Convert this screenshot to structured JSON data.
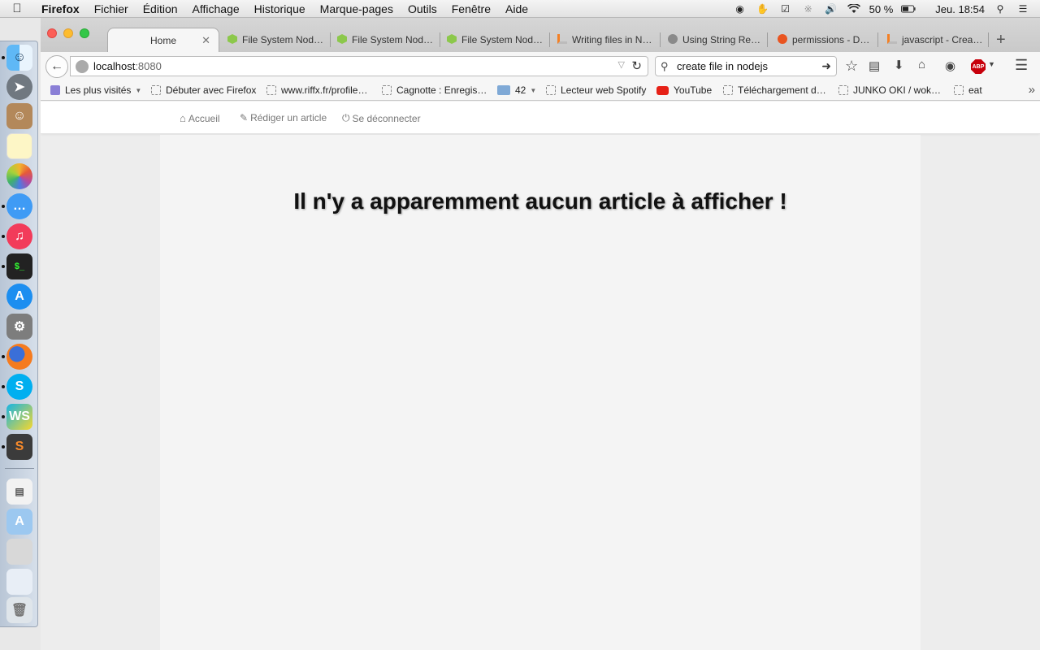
{
  "menubar": {
    "app": "Firefox",
    "items": [
      "Fichier",
      "Édition",
      "Affichage",
      "Historique",
      "Marque-pages",
      "Outils",
      "Fenêtre",
      "Aide"
    ],
    "battery": "50 %",
    "clock": "Jeu. 18:54"
  },
  "tabs": [
    {
      "label": "Home",
      "active": true
    },
    {
      "label": "File System Nod…"
    },
    {
      "label": "File System Nod…"
    },
    {
      "label": "File System Nod…"
    },
    {
      "label": "Writing files in N…"
    },
    {
      "label": "Using String Re…"
    },
    {
      "label": "permissions - D…"
    },
    {
      "label": "javascript - Crea…"
    }
  ],
  "navbar": {
    "url_host": "localhost",
    "url_port": ":8080",
    "search_value": "create file in nodejs"
  },
  "bookmarks": [
    {
      "label": "Les plus visités"
    },
    {
      "label": "Débuter avec Firefox"
    },
    {
      "label": "www.riffx.fr/profile…"
    },
    {
      "label": "Cagnotte : Enregis…"
    },
    {
      "label": "42"
    },
    {
      "label": "Lecteur web Spotify"
    },
    {
      "label": "YouTube"
    },
    {
      "label": "Téléchargement d…"
    },
    {
      "label": "JUNKO OKI / wok…"
    },
    {
      "label": "eat"
    }
  ],
  "site": {
    "nav": {
      "home": "Accueil",
      "write": "Rédiger un article",
      "logout": "Se déconnecter"
    },
    "empty_message": "Il n'y a apparemment aucun article à afficher !"
  },
  "colors": {
    "close": "#fc5f57",
    "minimize": "#fdbc2e",
    "zoom": "#33c748",
    "youtube": "#e62117",
    "abp": "#c7000b"
  }
}
